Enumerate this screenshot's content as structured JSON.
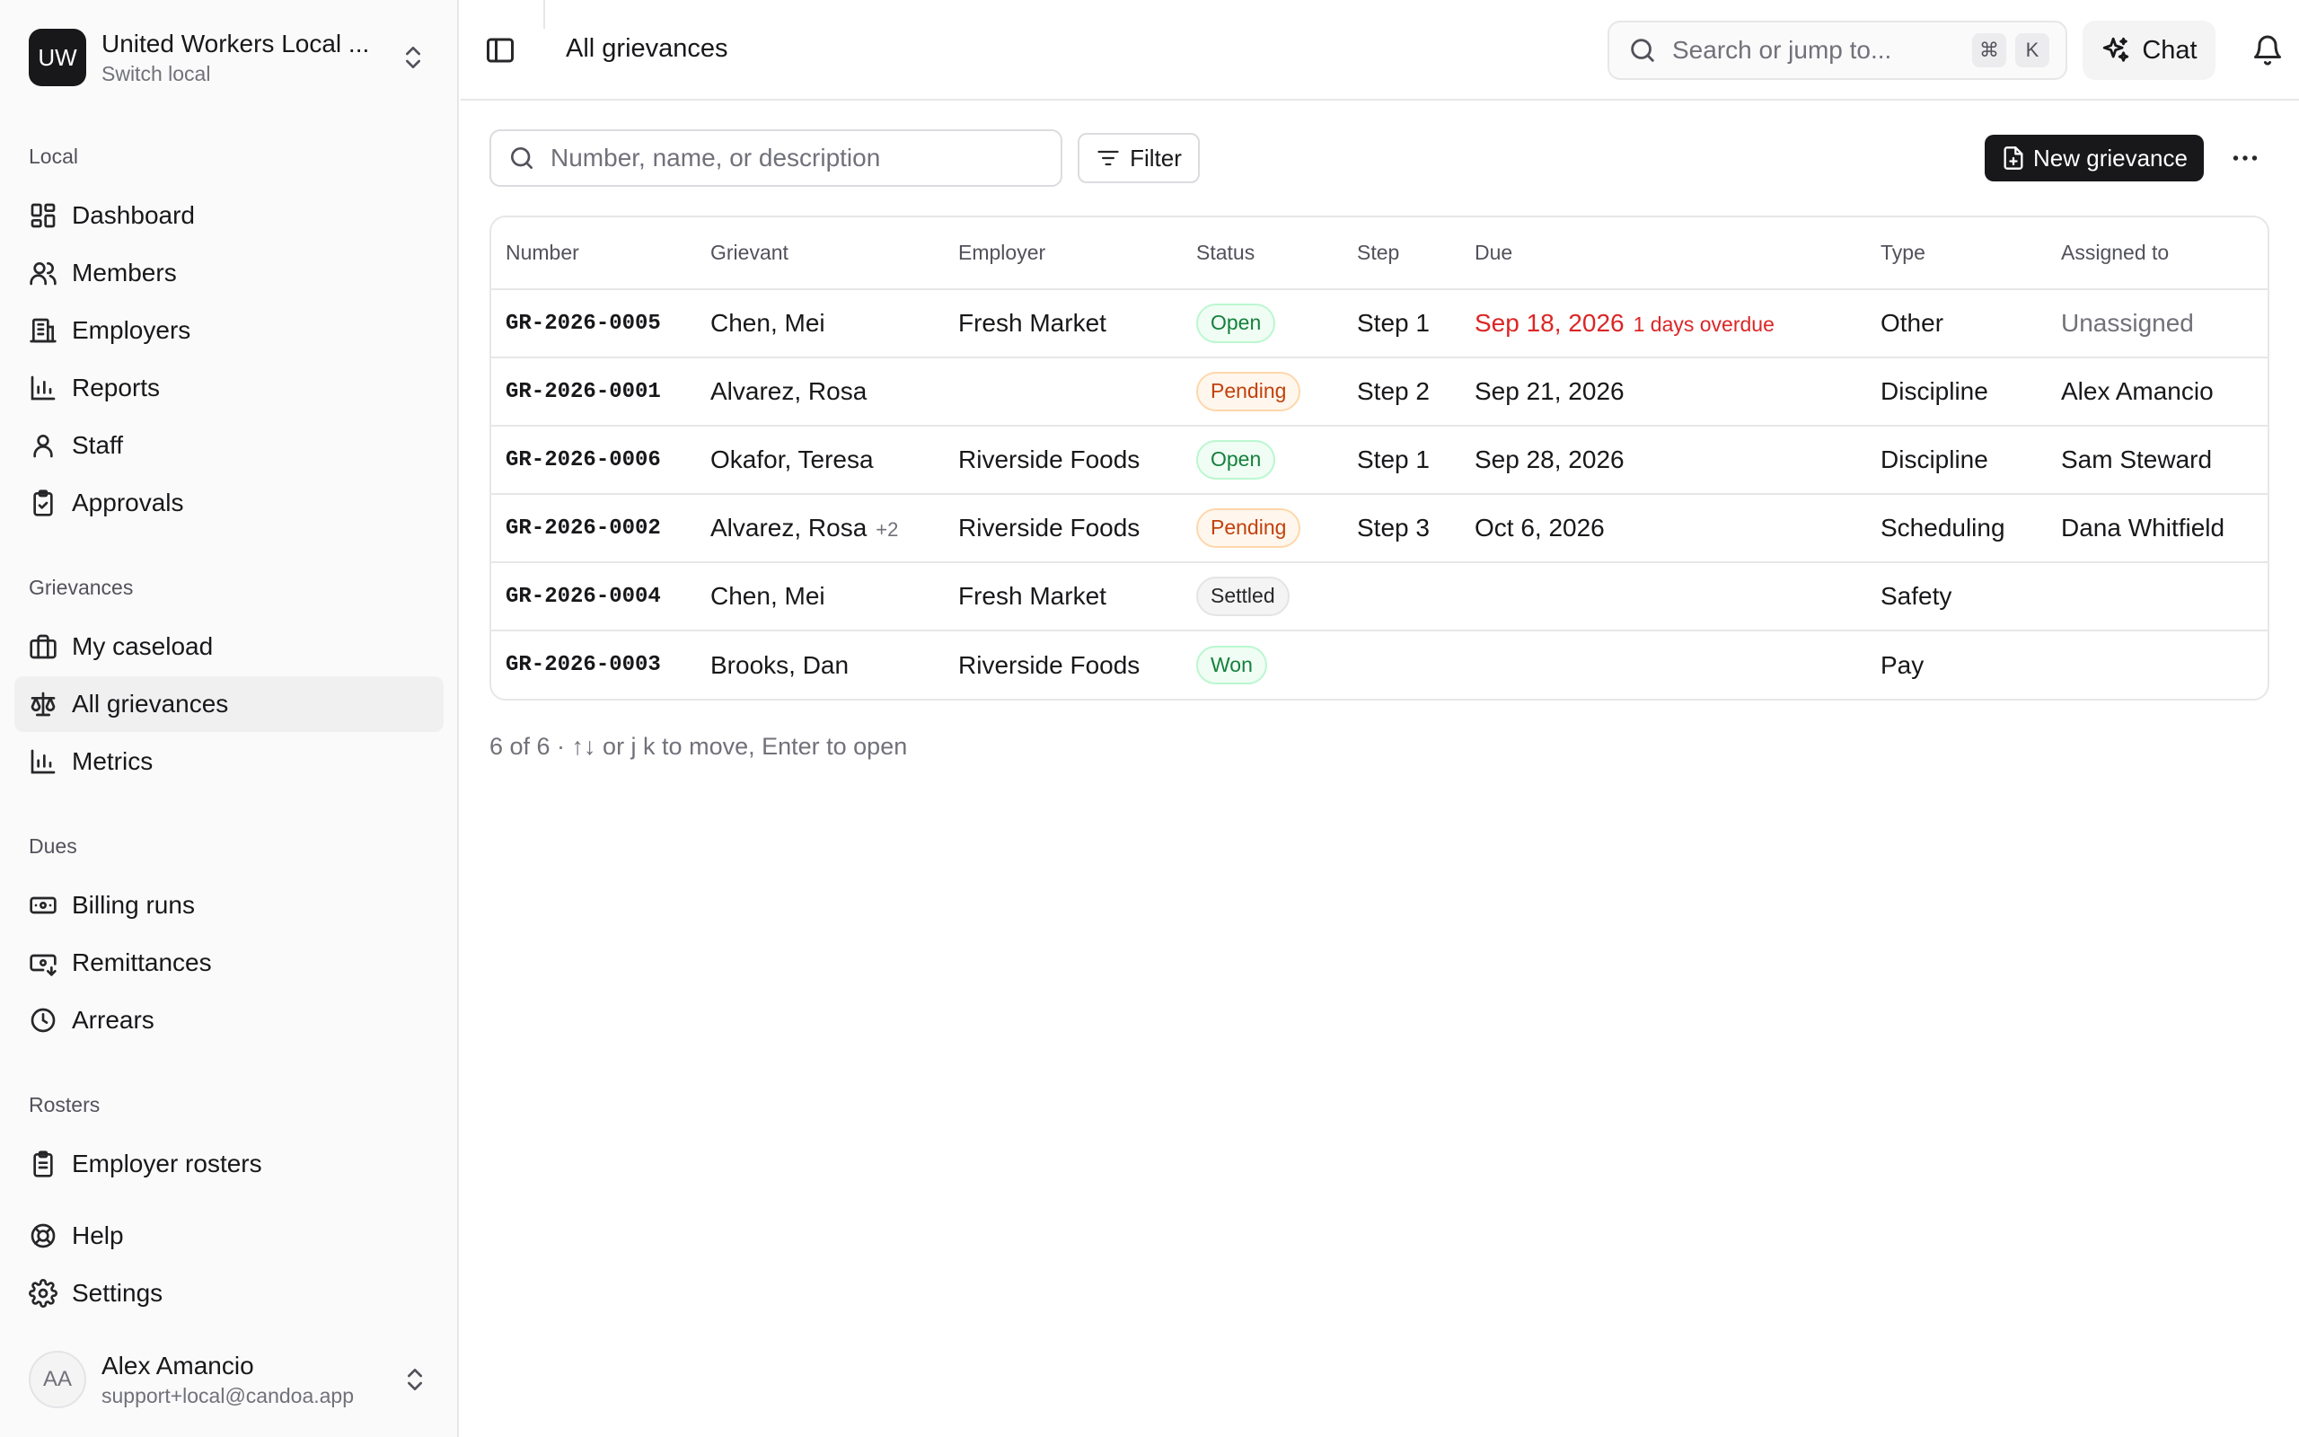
{
  "org": {
    "logo": "UW",
    "name": "United Workers Local ...",
    "switch_label": "Switch local"
  },
  "sidebar": {
    "sections": {
      "local": "Local",
      "grievances": "Grievances",
      "dues": "Dues",
      "rosters": "Rosters"
    },
    "items": {
      "dashboard": "Dashboard",
      "members": "Members",
      "employers": "Employers",
      "reports": "Reports",
      "staff": "Staff",
      "approvals": "Approvals",
      "my_caseload": "My caseload",
      "all_grievances": "All grievances",
      "metrics": "Metrics",
      "billing_runs": "Billing runs",
      "remittances": "Remittances",
      "arrears": "Arrears",
      "employer_rosters": "Employer rosters",
      "help": "Help",
      "settings": "Settings"
    }
  },
  "user": {
    "initials": "AA",
    "name": "Alex Amancio",
    "email": "support+local@candoa.app"
  },
  "topbar": {
    "title": "All grievances",
    "search_placeholder": "Search or jump to...",
    "shortcut_1": "⌘",
    "shortcut_2": "K",
    "chat_label": "Chat"
  },
  "toolbar": {
    "search_placeholder": "Number, name, or description",
    "filter_label": "Filter",
    "new_label": "New grievance"
  },
  "table": {
    "columns": {
      "number": "Number",
      "grievant": "Grievant",
      "employer": "Employer",
      "status": "Status",
      "step": "Step",
      "due": "Due",
      "type": "Type",
      "assigned": "Assigned to"
    },
    "rows": [
      {
        "number": "GR-2026-0005",
        "grievant": "Chen, Mei",
        "extra": "",
        "employer": "Fresh Market",
        "status": "Open",
        "status_kind": "open",
        "step": "Step 1",
        "due": "Sep 18, 2026",
        "overdue_note": "1 days overdue",
        "type": "Other",
        "assigned": "Unassigned"
      },
      {
        "number": "GR-2026-0001",
        "grievant": "Alvarez, Rosa",
        "extra": "",
        "employer": "",
        "status": "Pending",
        "status_kind": "pending",
        "step": "Step 2",
        "due": "Sep 21, 2026",
        "overdue_note": "",
        "type": "Discipline",
        "assigned": "Alex Amancio"
      },
      {
        "number": "GR-2026-0006",
        "grievant": "Okafor, Teresa",
        "extra": "",
        "employer": "Riverside Foods",
        "status": "Open",
        "status_kind": "open",
        "step": "Step 1",
        "due": "Sep 28, 2026",
        "overdue_note": "",
        "type": "Discipline",
        "assigned": "Sam Steward"
      },
      {
        "number": "GR-2026-0002",
        "grievant": "Alvarez, Rosa",
        "extra": "+2",
        "employer": "Riverside Foods",
        "status": "Pending",
        "status_kind": "pending",
        "step": "Step 3",
        "due": "Oct 6, 2026",
        "overdue_note": "",
        "type": "Scheduling",
        "assigned": "Dana Whitfield"
      },
      {
        "number": "GR-2026-0004",
        "grievant": "Chen, Mei",
        "extra": "",
        "employer": "Fresh Market",
        "status": "Settled",
        "status_kind": "settled",
        "step": "",
        "due": "",
        "overdue_note": "",
        "type": "Safety",
        "assigned": ""
      },
      {
        "number": "GR-2026-0003",
        "grievant": "Brooks, Dan",
        "extra": "",
        "employer": "Riverside Foods",
        "status": "Won",
        "status_kind": "won",
        "step": "",
        "due": "",
        "overdue_note": "",
        "type": "Pay",
        "assigned": ""
      }
    ]
  },
  "footer_hint": "6 of 6 · ↑↓ or j k to move, Enter to open",
  "colors": {
    "accent": "#18181b",
    "overdue": "#dc2626",
    "open": "#15803d",
    "pending": "#c2410c"
  }
}
